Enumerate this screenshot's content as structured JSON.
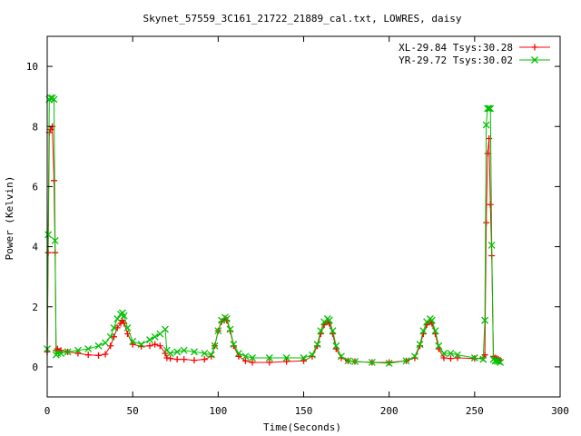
{
  "chart_data": {
    "type": "line",
    "title": "Skynet_57559_3C161_21722_21889_cal.txt, LOWRES, daisy",
    "xlabel": "Time(Seconds)",
    "ylabel": "Power (Kelvin)",
    "xlim": [
      0,
      300
    ],
    "ylim": [
      -1,
      11
    ],
    "xticks": [
      0,
      50,
      100,
      150,
      200,
      250,
      300
    ],
    "yticks": [
      0,
      2,
      4,
      6,
      8,
      10
    ],
    "grid": false,
    "legend_position": "top-right",
    "series": [
      {
        "name": "XL-29.84 Tsys:30.28",
        "color": "#ff0000",
        "marker": "+",
        "x": [
          0,
          0.6,
          1.2,
          2,
          3,
          4,
          4.6,
          5.2,
          6,
          8,
          12,
          18,
          24,
          30,
          34,
          37,
          39,
          41,
          43,
          44,
          45,
          47,
          50,
          55,
          60,
          63,
          66,
          69,
          70,
          72,
          76,
          80,
          86,
          92,
          96,
          98,
          100,
          102,
          104,
          105,
          107,
          109,
          112,
          116,
          120,
          130,
          140,
          150,
          155,
          158,
          160,
          162,
          164,
          165,
          167,
          169,
          172,
          176,
          180,
          190,
          200,
          210,
          215,
          218,
          220,
          222,
          224,
          225,
          227,
          229,
          232,
          236,
          240,
          250,
          255,
          256,
          256.8,
          257.6,
          258.4,
          259.2,
          260,
          261,
          262,
          263,
          264,
          265
        ],
        "y": [
          0.5,
          3.8,
          7.8,
          7.9,
          8.0,
          6.2,
          3.8,
          0.55,
          0.6,
          0.55,
          0.5,
          0.45,
          0.4,
          0.38,
          0.42,
          0.7,
          1.0,
          1.3,
          1.45,
          1.55,
          1.45,
          1.1,
          0.75,
          0.68,
          0.7,
          0.75,
          0.7,
          0.45,
          0.3,
          0.28,
          0.25,
          0.25,
          0.22,
          0.25,
          0.35,
          0.7,
          1.2,
          1.5,
          1.6,
          1.55,
          1.2,
          0.7,
          0.35,
          0.2,
          0.15,
          0.15,
          0.18,
          0.2,
          0.35,
          0.7,
          1.1,
          1.4,
          1.5,
          1.45,
          1.1,
          0.6,
          0.3,
          0.2,
          0.18,
          0.15,
          0.15,
          0.2,
          0.3,
          0.7,
          1.1,
          1.4,
          1.5,
          1.45,
          1.1,
          0.6,
          0.3,
          0.28,
          0.3,
          0.28,
          0.3,
          0.4,
          4.8,
          7.1,
          7.6,
          5.4,
          3.7,
          0.35,
          0.3,
          0.28,
          0.25,
          0.22
        ]
      },
      {
        "name": "YR-29.72 Tsys:30.02",
        "color": "#00c000",
        "marker": "x",
        "x": [
          0,
          0.6,
          1.2,
          2,
          3,
          4,
          4.6,
          5.2,
          6,
          8,
          12,
          18,
          24,
          30,
          34,
          37,
          39,
          41,
          43,
          44,
          45,
          47,
          50,
          55,
          60,
          63,
          66,
          69,
          70,
          72,
          76,
          80,
          86,
          92,
          96,
          98,
          100,
          102,
          104,
          105,
          107,
          109,
          112,
          116,
          120,
          130,
          140,
          150,
          155,
          158,
          160,
          162,
          164,
          165,
          167,
          169,
          172,
          176,
          180,
          190,
          200,
          210,
          215,
          218,
          220,
          222,
          224,
          225,
          227,
          229,
          232,
          236,
          240,
          250,
          255,
          256,
          256.8,
          257.6,
          258.4,
          259.2,
          260,
          261,
          262,
          263,
          264,
          265
        ],
        "y": [
          0.6,
          4.4,
          8.9,
          8.95,
          8.95,
          8.9,
          4.2,
          0.4,
          0.45,
          0.45,
          0.5,
          0.55,
          0.6,
          0.7,
          0.8,
          1.0,
          1.3,
          1.6,
          1.75,
          1.8,
          1.7,
          1.3,
          0.85,
          0.75,
          0.9,
          1.0,
          1.1,
          1.25,
          0.55,
          0.45,
          0.5,
          0.55,
          0.5,
          0.45,
          0.4,
          0.7,
          1.2,
          1.55,
          1.65,
          1.6,
          1.25,
          0.75,
          0.45,
          0.35,
          0.3,
          0.3,
          0.3,
          0.3,
          0.4,
          0.75,
          1.2,
          1.5,
          1.6,
          1.55,
          1.2,
          0.7,
          0.35,
          0.2,
          0.18,
          0.15,
          0.12,
          0.2,
          0.35,
          0.75,
          1.2,
          1.5,
          1.6,
          1.55,
          1.2,
          0.7,
          0.45,
          0.45,
          0.4,
          0.3,
          0.25,
          1.55,
          8.05,
          8.6,
          8.6,
          8.6,
          4.05,
          0.25,
          0.2,
          0.2,
          0.18,
          0.15
        ]
      }
    ]
  }
}
